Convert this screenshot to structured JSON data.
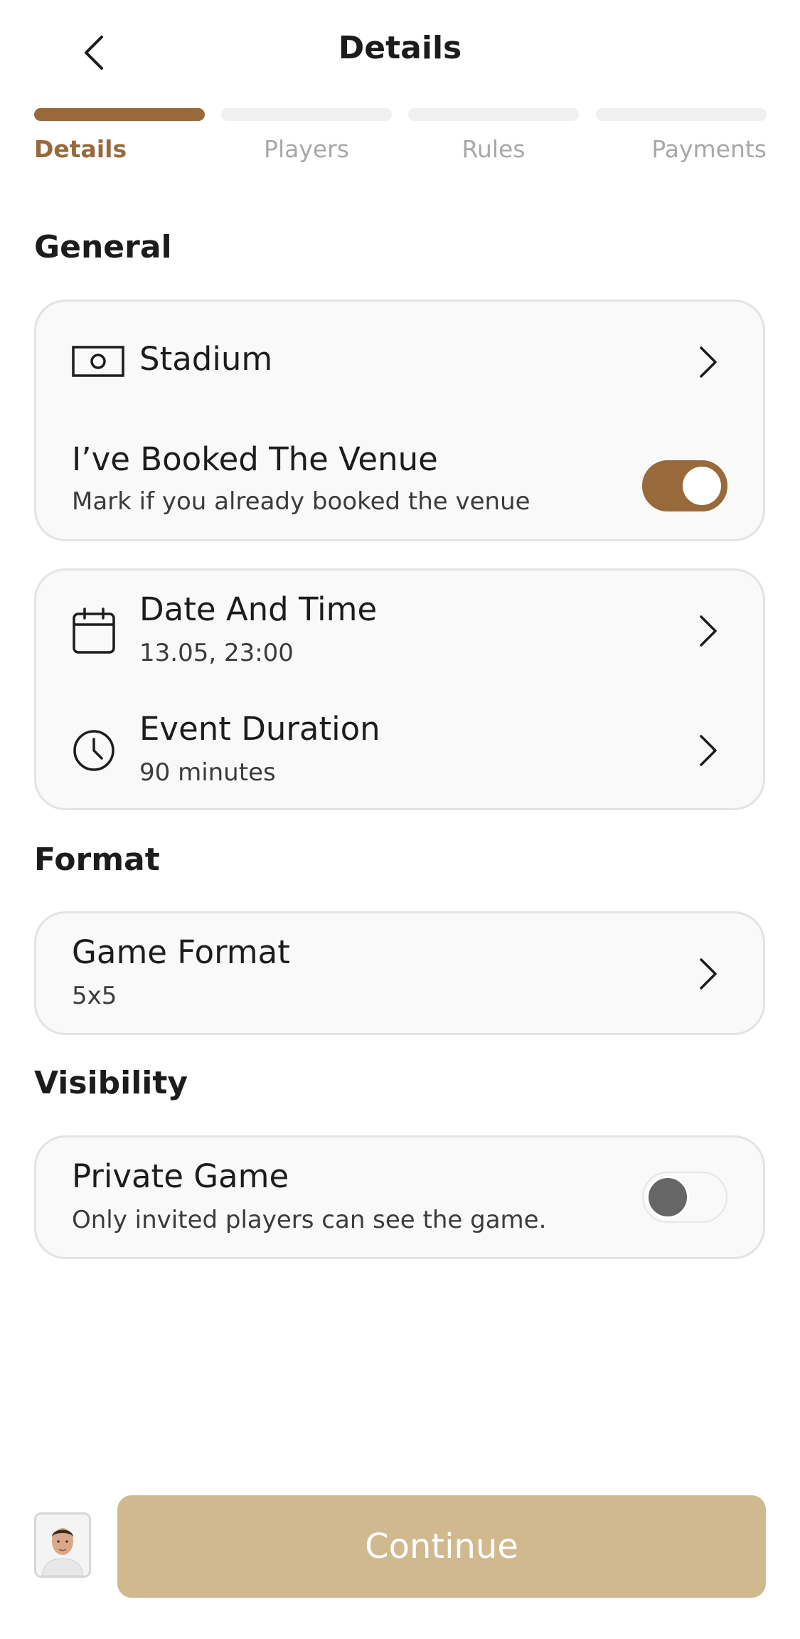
{
  "header": {
    "title": "Details"
  },
  "steps": [
    {
      "label": "Details",
      "active": true
    },
    {
      "label": "Players",
      "active": false
    },
    {
      "label": "Rules",
      "active": false
    },
    {
      "label": "Payments",
      "active": false
    }
  ],
  "sections": {
    "general": "General",
    "format": "Format",
    "visibility": "Visibility"
  },
  "general": {
    "stadium": {
      "title": "Stadium",
      "icon": "stadium-icon"
    },
    "booked": {
      "title": "I’ve Booked The Venue",
      "subtitle": "Mark if you already booked the venue",
      "enabled": true
    },
    "datetime": {
      "title": "Date And Time",
      "value": "13.05, 23:00",
      "icon": "calendar-icon"
    },
    "duration": {
      "title": "Event Duration",
      "value": "90 minutes",
      "icon": "clock-icon"
    }
  },
  "format": {
    "game_format": {
      "title": "Game Format",
      "value": "5x5"
    }
  },
  "visibility": {
    "private_game": {
      "title": "Private Game",
      "subtitle": "Only invited players can see the game.",
      "enabled": false
    }
  },
  "footer": {
    "continue_label": "Continue"
  },
  "colors": {
    "accent": "#98693b",
    "continue_button": "#d0b98f",
    "card_background": "#f9f9f9"
  }
}
